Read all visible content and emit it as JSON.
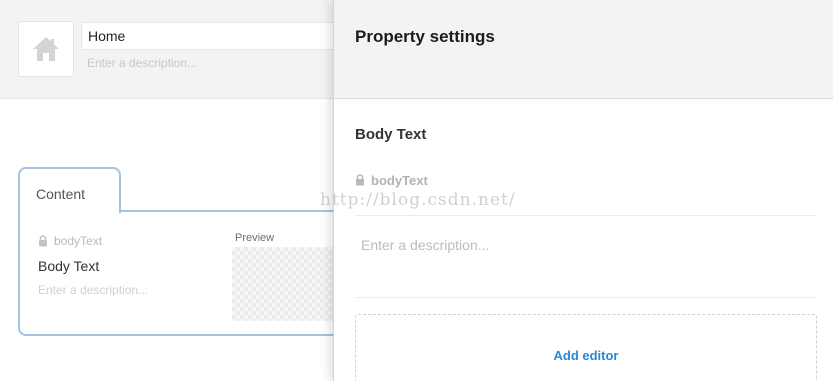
{
  "editor": {
    "name_value": "Home",
    "description_placeholder": "Enter a description...",
    "icon": "home-icon"
  },
  "content_tab": {
    "label": "Content",
    "property": {
      "alias": "bodyText",
      "name": "Body Text",
      "description_placeholder": "Enter a description...",
      "preview_label": "Preview"
    }
  },
  "settings": {
    "title": "Property settings",
    "property_name": "Body Text",
    "alias": "bodyText",
    "description_placeholder": "Enter a description...",
    "add_editor_label": "Add editor",
    "lock_icon": "lock-icon"
  },
  "watermark": "http://blog.csdn.net/",
  "colors": {
    "accent_link": "#2e86d6",
    "tab_border": "#a4c4df",
    "header_bg": "#f3f3f5"
  }
}
